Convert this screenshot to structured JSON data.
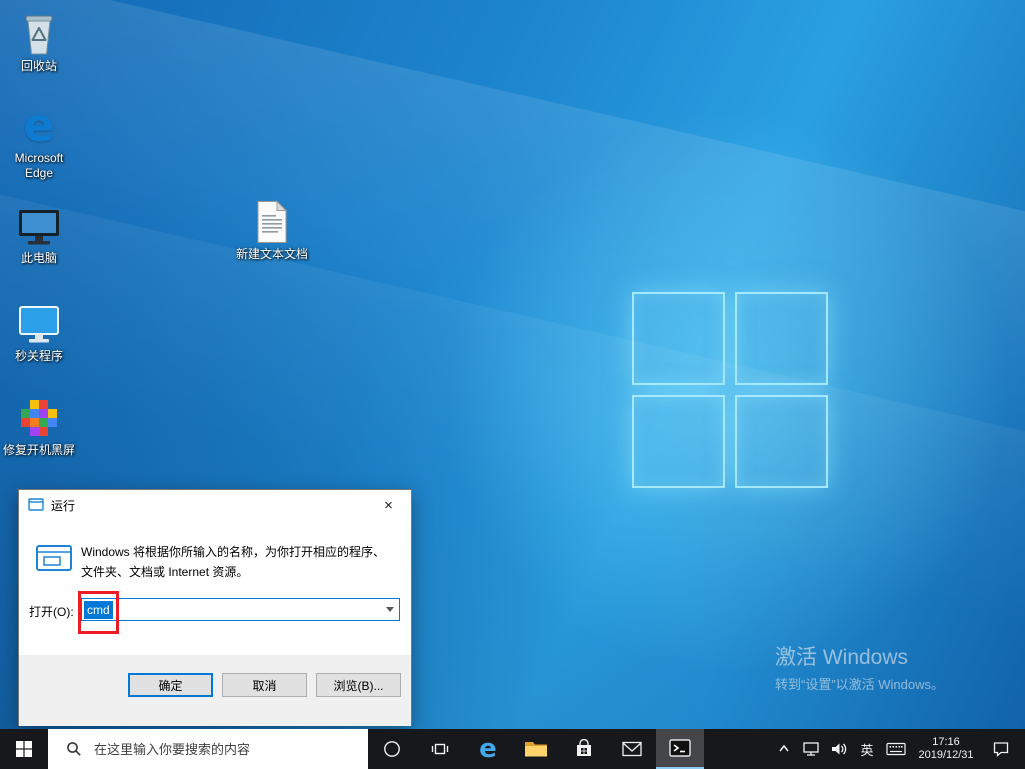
{
  "desktop": {
    "icons": {
      "recycle_bin": "回收站",
      "edge": "Microsoft Edge",
      "this_pc": "此电脑",
      "quick_close": "秒关程序",
      "fix_black_screen": "修复开机黑屏",
      "new_text_doc": "新建文本文档"
    },
    "activation": {
      "line1": "激活 Windows",
      "line2": "转到“设置”以激活 Windows。"
    }
  },
  "run_dialog": {
    "title": "运行",
    "close_glyph": "×",
    "description_line1": "Windows 将根据你所输入的名称，为你打开相应的程序、",
    "description_line2": "文件夹、文档或 Internet 资源。",
    "open_label": "打开(O):",
    "input_value": "cmd",
    "ok_label": "确定",
    "cancel_label": "取消",
    "browse_label": "浏览(B)..."
  },
  "taskbar": {
    "search_placeholder": "在这里输入你要搜索的内容",
    "language_indicator": "英",
    "clock": {
      "time": "17:16",
      "date": "2019/12/31"
    }
  }
}
